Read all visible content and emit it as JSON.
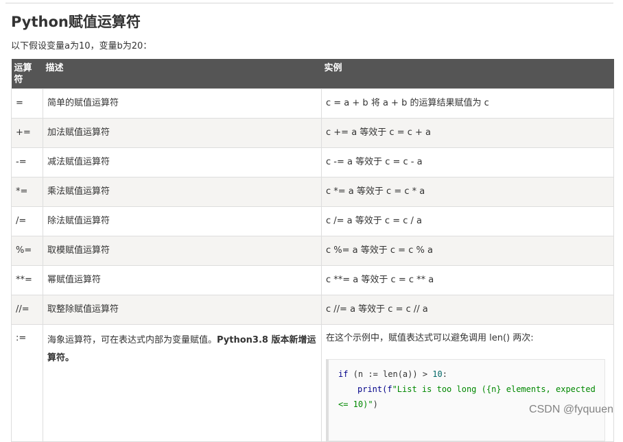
{
  "title": "Python赋值运算符",
  "intro": "以下假设变量a为10，变量b为20：",
  "table": {
    "headers": [
      "运算符",
      "描述",
      "实例"
    ],
    "rows": [
      {
        "op": "=",
        "desc": "简单的赋值运算符",
        "example": "c = a + b 将 a + b 的运算结果赋值为 c"
      },
      {
        "op": "+=",
        "desc": "加法赋值运算符",
        "example": "c += a 等效于 c = c + a"
      },
      {
        "op": "-=",
        "desc": "减法赋值运算符",
        "example": "c -= a 等效于 c = c - a"
      },
      {
        "op": "*=",
        "desc": "乘法赋值运算符",
        "example": "c *= a 等效于 c = c * a"
      },
      {
        "op": "/=",
        "desc": "除法赋值运算符",
        "example": "c /= a 等效于 c = c / a"
      },
      {
        "op": "%=",
        "desc": "取模赋值运算符",
        "example": "c %= a 等效于 c = c % a"
      },
      {
        "op": "**=",
        "desc": "幂赋值运算符",
        "example": "c **= a 等效于 c = c ** a"
      },
      {
        "op": "//=",
        "desc": "取整除赋值运算符",
        "example": "c //= a 等效于 c = c // a"
      }
    ],
    "last_row": {
      "op": ":=",
      "desc_plain": "海象运算符，可在表达式内部为变量赋值。",
      "desc_bold": "Python3.8 版本新增运算符。",
      "example_text": "在这个示例中，赋值表达式可以避免调用 len() 两次:",
      "code": {
        "line1_kw": "if",
        "line1_mid": " (n := len(a)) > ",
        "line1_num": "10",
        "line1_end": ":",
        "line2_fn": "print(f",
        "line2_str": "\"List is too long ({n} elements, expected",
        "line3_str": "<= 10)\"",
        "line3_end": ")"
      }
    }
  },
  "watermark": "CSDN @fyquuen"
}
